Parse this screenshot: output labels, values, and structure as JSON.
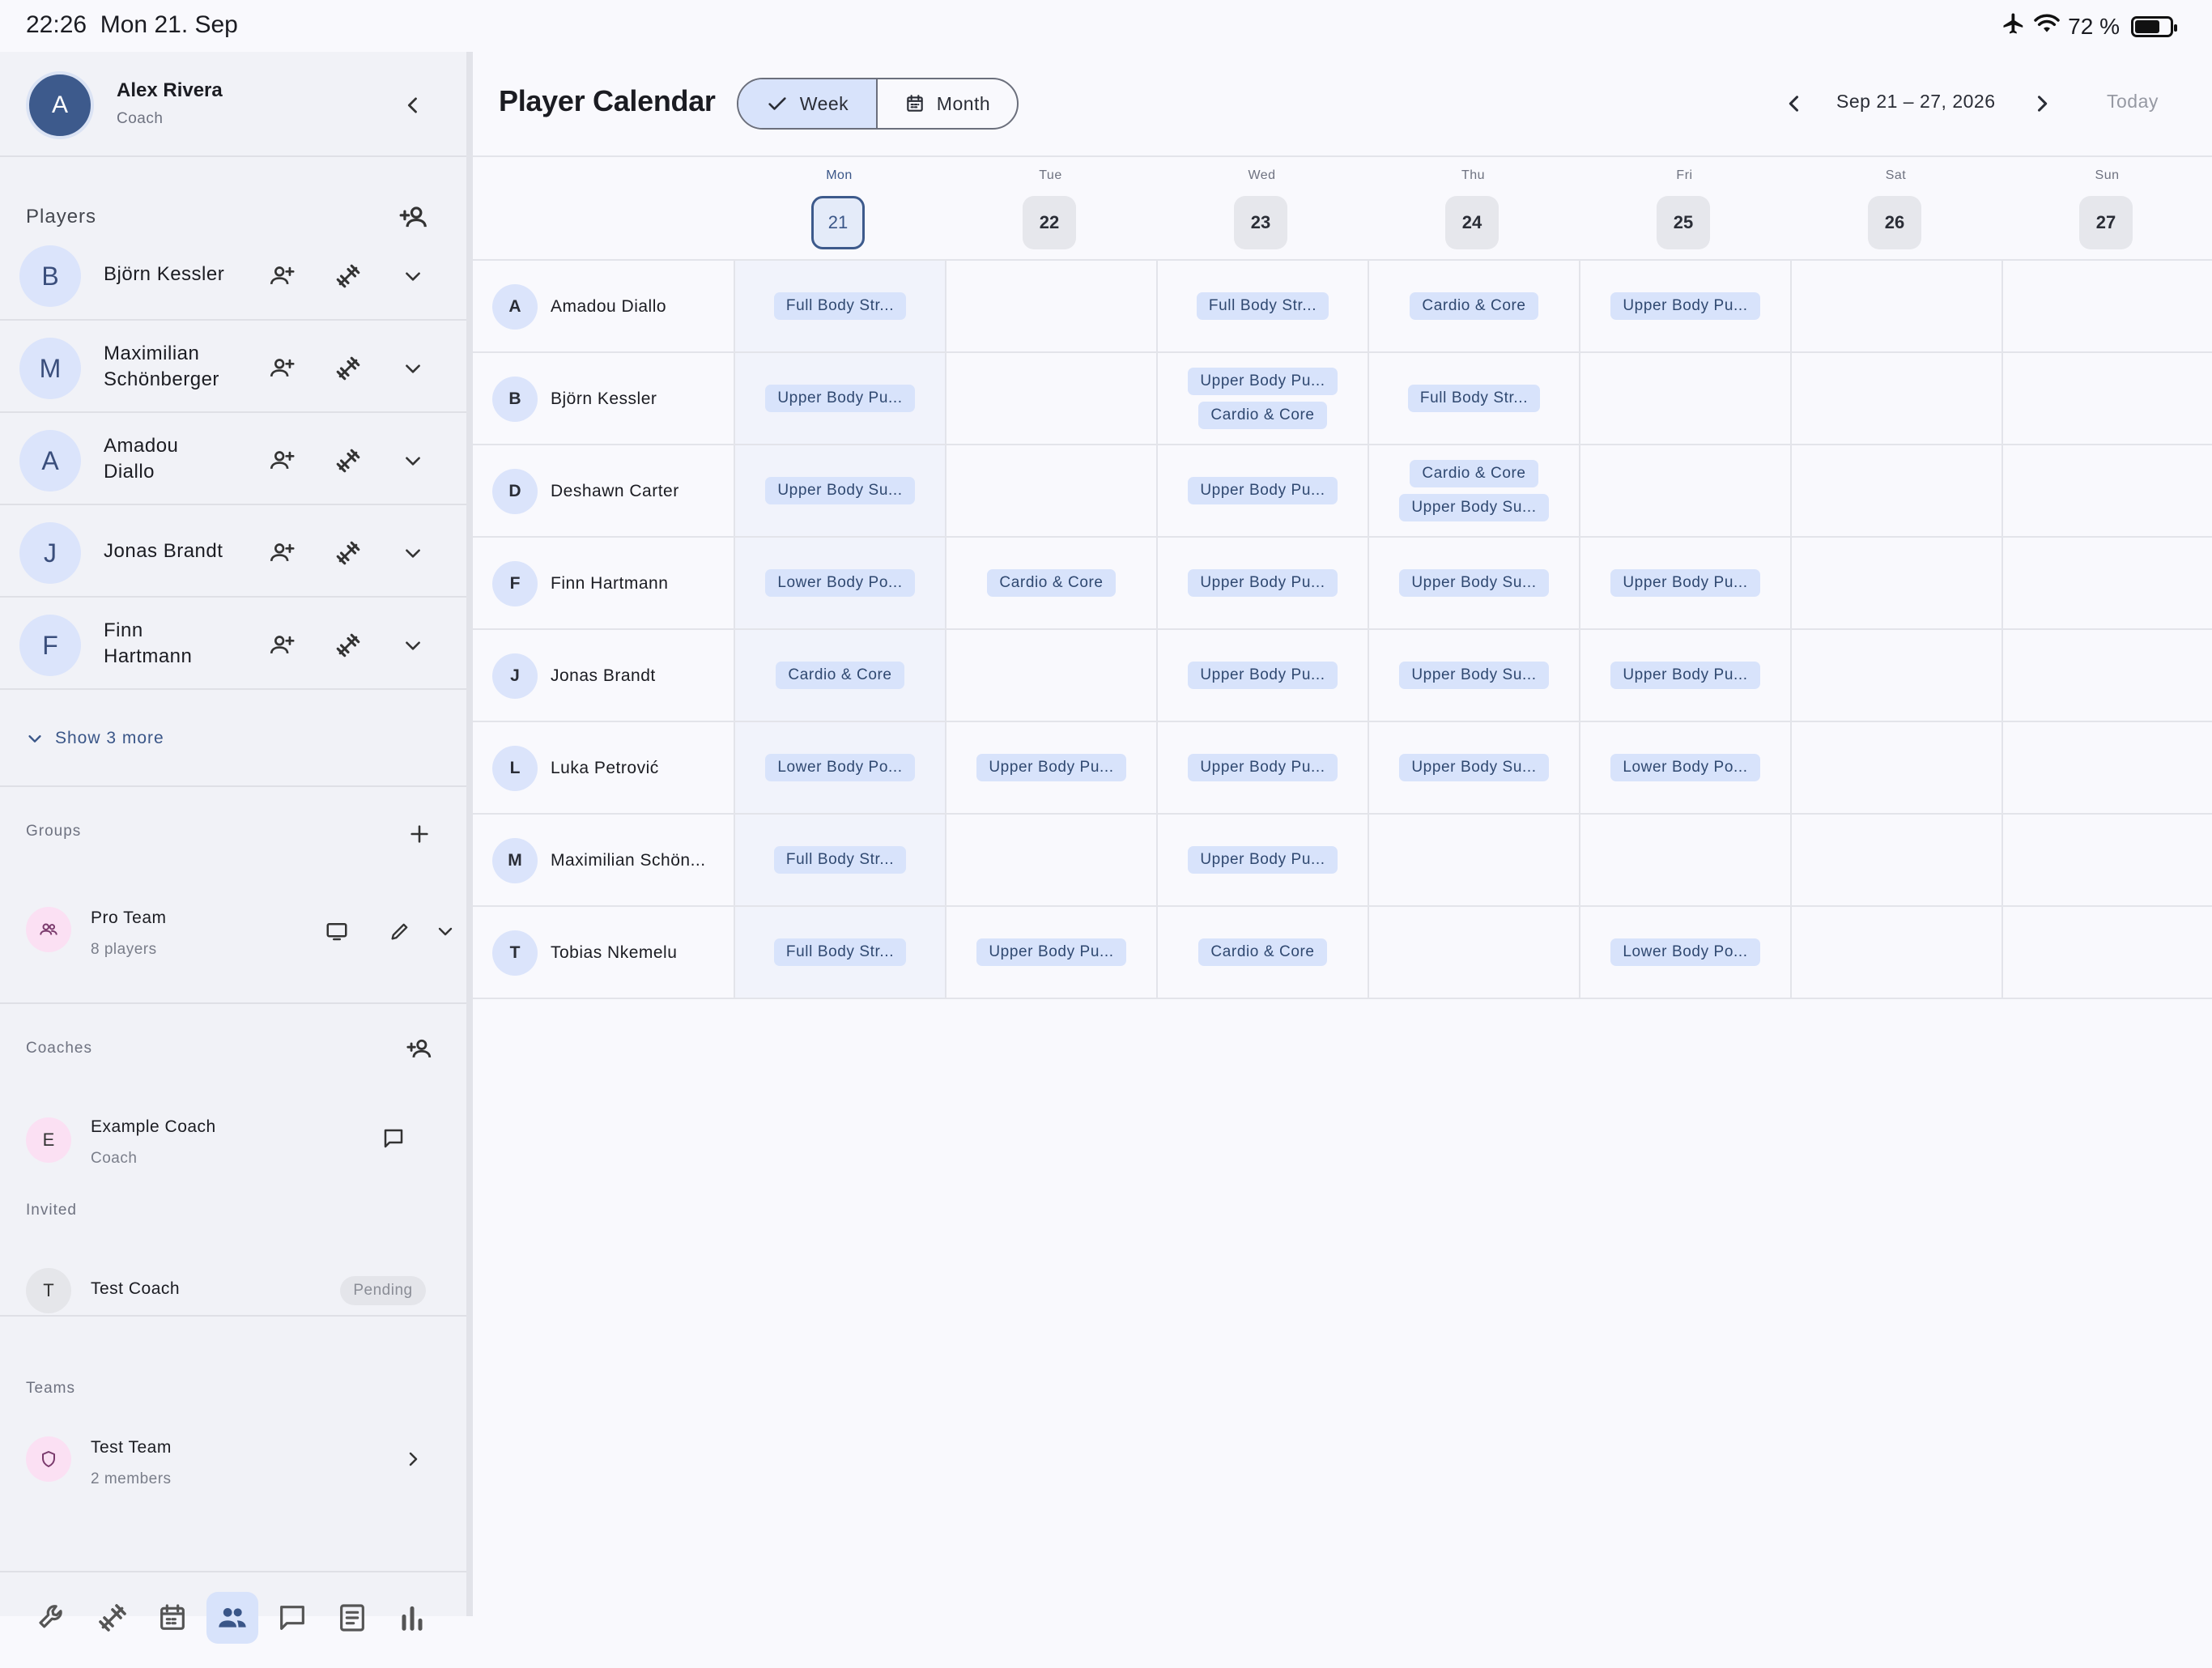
{
  "status_bar": {
    "time": "22:26",
    "date": "Mon 21. Sep",
    "battery": "72 %",
    "battery_level": 0.72
  },
  "sidebar": {
    "profile": {
      "initial": "A",
      "name": "Alex Rivera",
      "role": "Coach"
    },
    "players_title": "Players",
    "players": [
      {
        "initial": "B",
        "name": "Björn Kessler"
      },
      {
        "initial": "M",
        "name": "Maximilian Schönberger"
      },
      {
        "initial": "A",
        "name": "Amadou Diallo"
      },
      {
        "initial": "J",
        "name": "Jonas Brandt"
      },
      {
        "initial": "F",
        "name": "Finn Hartmann"
      }
    ],
    "show_more": "Show 3 more",
    "groups_title": "Groups",
    "group": {
      "name": "Pro Team",
      "count": "8 players"
    },
    "coaches_title": "Coaches",
    "coach": {
      "initial": "E",
      "name": "Example Coach",
      "role": "Coach"
    },
    "invited_title": "Invited",
    "invited": {
      "initial": "T",
      "name": "Test Coach",
      "status": "Pending"
    },
    "teams_title": "Teams",
    "team": {
      "name": "Test Team",
      "count": "2 members"
    },
    "bottom_nav": [
      "wrench-icon",
      "dumbbell-icon",
      "calendar-icon",
      "people-icon",
      "chat-icon",
      "notes-icon",
      "bar-chart-icon"
    ],
    "bottom_nav_active": "people-icon"
  },
  "main": {
    "title": "Player Calendar",
    "view_week": "Week",
    "view_month": "Month",
    "date_range": "Sep 21 – 27, 2026",
    "today": "Today",
    "days": [
      {
        "name": "Mon",
        "num": "21",
        "today": true
      },
      {
        "name": "Tue",
        "num": "22"
      },
      {
        "name": "Wed",
        "num": "23"
      },
      {
        "name": "Thu",
        "num": "24"
      },
      {
        "name": "Fri",
        "num": "25"
      },
      {
        "name": "Sat",
        "num": "26"
      },
      {
        "name": "Sun",
        "num": "27"
      }
    ],
    "rows": [
      {
        "initial": "A",
        "name": "Amadou Diallo",
        "cells": [
          [
            "Full Body Str..."
          ],
          [],
          [
            "Full Body Str..."
          ],
          [
            "Cardio & Core"
          ],
          [
            "Upper Body Pu..."
          ],
          [],
          []
        ]
      },
      {
        "initial": "B",
        "name": "Björn Kessler",
        "cells": [
          [
            "Upper Body Pu..."
          ],
          [],
          [
            "Upper Body Pu...",
            "Cardio & Core"
          ],
          [
            "Full Body Str..."
          ],
          [],
          [],
          []
        ]
      },
      {
        "initial": "D",
        "name": "Deshawn Carter",
        "cells": [
          [
            "Upper Body Su..."
          ],
          [],
          [
            "Upper Body Pu..."
          ],
          [
            "Cardio & Core",
            "Upper Body Su..."
          ],
          [],
          [],
          []
        ]
      },
      {
        "initial": "F",
        "name": "Finn Hartmann",
        "cells": [
          [
            "Lower Body Po..."
          ],
          [
            "Cardio & Core"
          ],
          [
            "Upper Body Pu..."
          ],
          [
            "Upper Body Su..."
          ],
          [
            "Upper Body Pu..."
          ],
          [],
          []
        ]
      },
      {
        "initial": "J",
        "name": "Jonas Brandt",
        "cells": [
          [
            "Cardio & Core"
          ],
          [],
          [
            "Upper Body Pu..."
          ],
          [
            "Upper Body Su..."
          ],
          [
            "Upper Body Pu..."
          ],
          [],
          []
        ]
      },
      {
        "initial": "L",
        "name": "Luka Petrović",
        "cells": [
          [
            "Lower Body Po..."
          ],
          [
            "Upper Body Pu..."
          ],
          [
            "Upper Body Pu..."
          ],
          [
            "Upper Body Su..."
          ],
          [
            "Lower Body Po..."
          ],
          [],
          []
        ]
      },
      {
        "initial": "M",
        "name": "Maximilian Schön...",
        "cells": [
          [
            "Full Body Str..."
          ],
          [],
          [
            "Upper Body Pu..."
          ],
          [],
          [],
          [],
          []
        ]
      },
      {
        "initial": "T",
        "name": "Tobias Nkemelu",
        "cells": [
          [
            "Full Body Str..."
          ],
          [
            "Upper Body Pu..."
          ],
          [
            "Cardio & Core"
          ],
          [],
          [
            "Lower Body Po..."
          ],
          [],
          []
        ]
      }
    ]
  },
  "colors": {
    "accent": "#3d5a8c",
    "chip_bg": "#d8e3fb",
    "chip_text": "#2f4870",
    "sidebar_bg": "#f1f2f7",
    "page_bg": "#f9f9fd"
  }
}
